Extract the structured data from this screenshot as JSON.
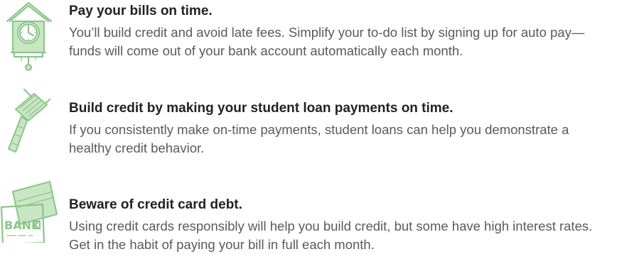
{
  "colors": {
    "accent": "#8cc58a",
    "accent_light": "#c9e6c4",
    "title": "#222222",
    "body": "#5a5a5a"
  },
  "tips": [
    {
      "icon": "cuckoo-clock-icon",
      "title": "Pay your bills on time.",
      "body": "You’ll build credit and avoid late fees. Simplify your to-do list by signing up for auto pay—funds will come out of your bank account automatically each month."
    },
    {
      "icon": "hammer-icon",
      "title": "Build credit by making your student loan payments on time.",
      "body": "If you consistently make on-time payments, student loans can help you demonstrate a healthy credit behavior."
    },
    {
      "icon": "bank-card-icon",
      "title": "Beware of credit card debt.",
      "icon_text": "BANK",
      "body": "Using credit cards responsibly will help you build credit, but some have high interest rates. Get in the habit of paying your bill in full each month."
    }
  ]
}
